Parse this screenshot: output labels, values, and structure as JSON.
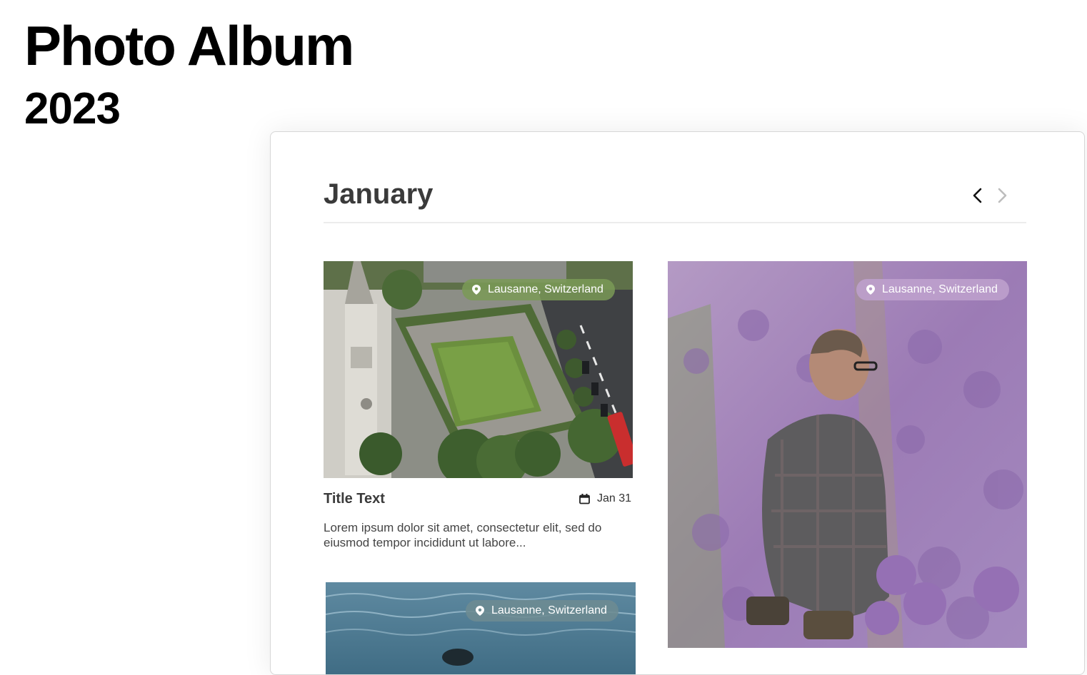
{
  "header": {
    "title": "Photo Album",
    "year": "2023"
  },
  "album": {
    "month": "January",
    "nav": {
      "prev_icon": "chevron-left-icon",
      "next_icon": "chevron-right-icon"
    },
    "photos": [
      {
        "location": "Lausanne, Switzerland",
        "scene": "aerial-park-church",
        "title": "Title Text",
        "date": "Jan 31",
        "date_icon": "calendar-icon",
        "excerpt": "Lorem ipsum dolor sit amet, consectetur elit, sed do eiusmod tempor incididunt ut labore..."
      },
      {
        "location": "Lausanne, Switzerland",
        "scene": "man-in-lavender-field"
      },
      {
        "location": "Lausanne, Switzerland",
        "scene": "water"
      }
    ]
  },
  "colors": {
    "badge_green": "#7a9a56",
    "badge_purple": "#b89bc7",
    "badge_teal": "#6d8b92",
    "text_dark": "#3b3b3b"
  }
}
